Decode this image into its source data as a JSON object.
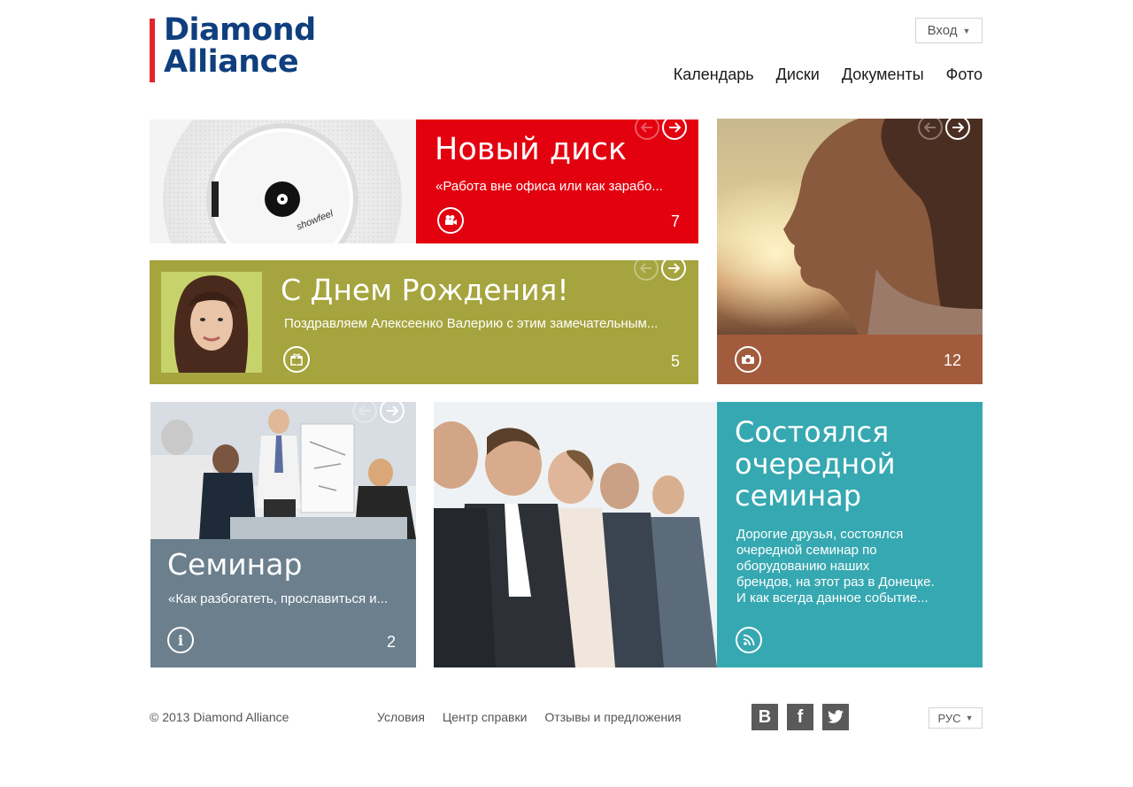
{
  "header": {
    "logo": {
      "line1": "Diamond",
      "line2": "Alliance"
    },
    "login_label": "Вход",
    "nav": [
      {
        "label": "Календарь"
      },
      {
        "label": "Диски"
      },
      {
        "label": "Документы"
      },
      {
        "label": "Фото"
      }
    ]
  },
  "tiles": {
    "disk": {
      "title": "Новый диск",
      "text": "«Работа вне офиса или как зарабо...",
      "count": "7",
      "color": "#e3000f",
      "image_caption": "showfeel"
    },
    "birthday": {
      "title": "С Днем Рождения!",
      "text": "Поздравляем Алексеенко Валерию с этим замечательным...",
      "count": "5",
      "color": "#a5a43e"
    },
    "photo": {
      "count": "12",
      "color": "#a25b3c"
    },
    "seminar": {
      "title": "Семинар",
      "text": "«Как разбогатеть, прославиться и...",
      "count": "2",
      "color": "#6b7f8d"
    },
    "news": {
      "title_lines": [
        "Состоялся",
        "очередной",
        "семинар"
      ],
      "text_lines": [
        "Дорогие друзья, состоялся",
        "очередной семинар по",
        "оборудованию наших",
        "брендов, на этот раз в Донецке.",
        "И как всегда данное событие..."
      ],
      "color": "#36a8b1"
    }
  },
  "footer": {
    "copyright": "© 2013 Diamond Alliance",
    "links": [
      {
        "label": "Условия"
      },
      {
        "label": "Центр справки"
      },
      {
        "label": "Отзывы и предложения"
      }
    ],
    "social": [
      {
        "label": "B",
        "icon": "vk-icon"
      },
      {
        "label": "f",
        "icon": "facebook-icon"
      },
      {
        "label": "twitter",
        "icon": "twitter-icon"
      }
    ],
    "language": "РУС"
  }
}
